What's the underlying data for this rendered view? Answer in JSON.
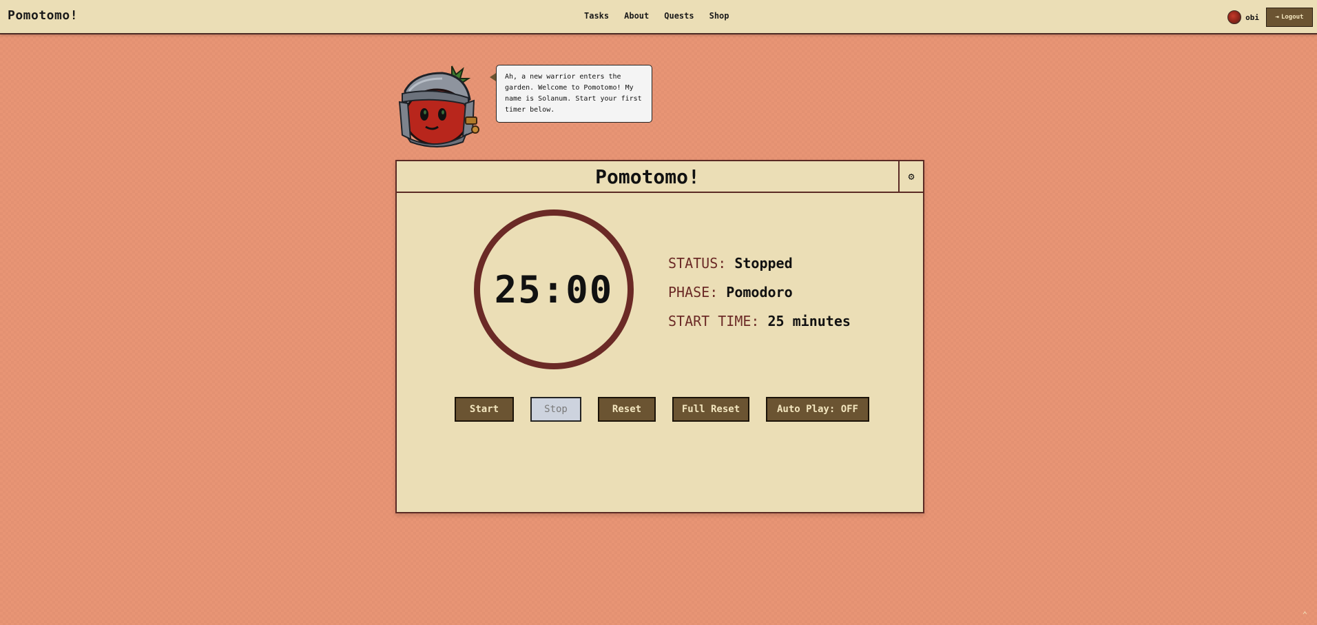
{
  "navbar": {
    "brand": "Pomotomo!",
    "links": [
      "Tasks",
      "About",
      "Quests",
      "Shop"
    ],
    "user": "obi",
    "logout_label": "Logout"
  },
  "mascot": {
    "speech": "Ah, a new warrior enters the garden. Welcome to Pomotomo! My name is Solanum. Start your first timer below."
  },
  "timer": {
    "title": "Pomotomo!",
    "display": "25:00",
    "status_label": "STATUS:",
    "status_value": "Stopped",
    "phase_label": "PHASE:",
    "phase_value": "Pomodoro",
    "start_label": "START TIME:",
    "start_value": "25 minutes"
  },
  "controls": {
    "start": "Start",
    "stop": "Stop",
    "reset": "Reset",
    "full_reset": "Full Reset",
    "autoplay": "Auto Play: OFF"
  },
  "colors": {
    "background": "#e89575",
    "panel": "#ebdeb6",
    "accent": "#6b2a26",
    "button": "#6b5432"
  },
  "icons": [
    "gear-icon",
    "logout-icon",
    "chevron-up-icon"
  ]
}
